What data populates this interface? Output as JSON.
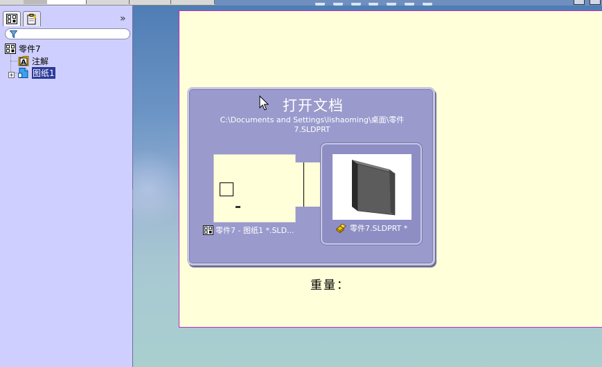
{
  "manager_pane": {
    "tabs": [
      {
        "icon": "feature-tree-icon",
        "active": true
      },
      {
        "icon": "property-manager-icon",
        "active": false
      }
    ],
    "expand_label": "»",
    "filter": {
      "icon": "filter-funnel-icon",
      "value": ""
    },
    "tree": {
      "root": {
        "label": "零件7",
        "icon": "drawing-icon"
      },
      "items": [
        {
          "label": "注解",
          "icon": "annotations-icon",
          "selected": false
        },
        {
          "label": "图纸1",
          "icon": "sheet-icon",
          "selected": true,
          "expand": "+"
        }
      ]
    }
  },
  "open_dialog": {
    "title": "打开文档",
    "path": "C:\\Documents and Settings\\lishaoming\\桌面\\零件7.SLDPRT",
    "items": [
      {
        "label": "零件7 - 图纸1 *.SLD...",
        "icon": "drawing-icon",
        "selected": false
      },
      {
        "label": "零件7.SLDPRT *",
        "icon": "part-icon",
        "selected": true
      }
    ]
  },
  "sheet": {
    "weight_label": "重量："
  },
  "colors": {
    "pane_bg": "#cfcfff",
    "sheet_bg": "#ffffd9",
    "dialog_bg": "#9a9acd",
    "selection": "#2a3a9a"
  }
}
